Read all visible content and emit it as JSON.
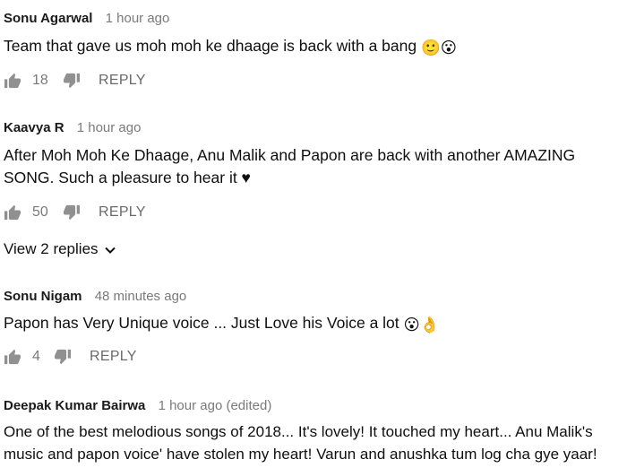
{
  "comments": [
    {
      "author": "Sonu Agarwal",
      "time": "1 hour ago",
      "text": "Team that gave us moh moh ke dhaage is back with a bang",
      "emoji": "🙂😮",
      "likes": "18",
      "reply_label": "REPLY"
    },
    {
      "author": "Kaavya R",
      "time": "1 hour ago",
      "text_line1": "After Moh Moh Ke Dhaage, Anu Malik and Papon are back with another AMAZING",
      "text_line2": "SONG. Such a pleasure to hear it ♥",
      "likes": "50",
      "reply_label": "REPLY",
      "view_replies": "View 2 replies"
    },
    {
      "author": "Sonu Nigam",
      "time": "48 minutes ago",
      "text": "Papon has Very Unique voice ... Just Love his Voice a lot",
      "emoji": "😮👌",
      "likes": "4",
      "reply_label": "REPLY"
    },
    {
      "author": "Deepak Kumar Bairwa",
      "time": "1 hour ago (edited)",
      "text_line1": "One of the best melodious songs of 2018... It's lovely! It touched my heart...  Anu Malik's",
      "text_line2": "music and papon voice' have stolen my heart! Varun and anushka tum log cha gye yaar!"
    }
  ],
  "icons": {
    "like": "thumbs-up-icon",
    "dislike": "thumbs-down-icon",
    "expand": "chevron-down-icon"
  },
  "colors": {
    "meta_gray": "#7a7a7a",
    "icon_gray": "#909090",
    "text": "#0f0f0f"
  }
}
